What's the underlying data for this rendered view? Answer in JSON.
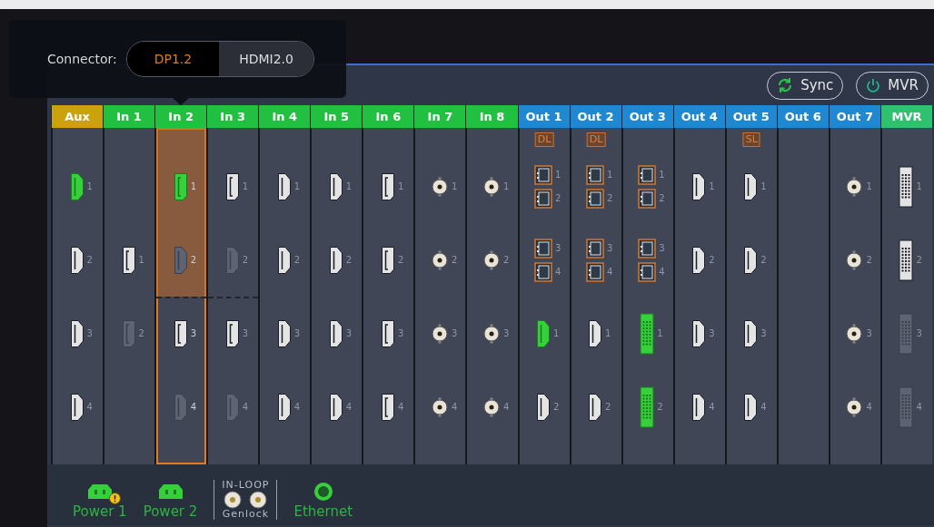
{
  "connector_popover": {
    "label": "Connector:",
    "options": [
      {
        "label": "DP1.2",
        "selected": true
      },
      {
        "label": "HDMI2.0",
        "selected": false
      }
    ]
  },
  "toolbar": {
    "buttons": [
      {
        "label": "Sync",
        "kind": "sync"
      },
      {
        "label": "MVR",
        "kind": "power"
      }
    ]
  },
  "columns": [
    {
      "label": "Aux",
      "kind": "aux",
      "selected": false,
      "slots": [
        [
          {
            "kind": "hdmi",
            "connected": true,
            "disabled": false,
            "label": "1"
          }
        ],
        [
          {
            "kind": "hdmi",
            "connected": false,
            "disabled": false,
            "label": "2"
          }
        ],
        [
          {
            "kind": "hdmi",
            "connected": false,
            "disabled": false,
            "label": "3"
          }
        ],
        [
          {
            "kind": "hdmi",
            "connected": false,
            "disabled": false,
            "label": "4"
          }
        ]
      ]
    },
    {
      "label": "In 1",
      "kind": "input",
      "selected": false,
      "slots": [
        [
          {
            "kind": "dp",
            "connected": false,
            "disabled": false,
            "label": "1"
          }
        ],
        [
          {
            "kind": "dp",
            "connected": false,
            "disabled": true,
            "label": "2"
          }
        ]
      ]
    },
    {
      "label": "In 2",
      "kind": "input",
      "selected": true,
      "slots": [
        [
          {
            "kind": "dp",
            "connected": true,
            "disabled": false,
            "label": "1"
          }
        ],
        [
          {
            "kind": "hdmi",
            "connected": false,
            "disabled": true,
            "label": "2"
          }
        ],
        [
          {
            "kind": "dp",
            "connected": false,
            "disabled": false,
            "label": "3"
          }
        ],
        [
          {
            "kind": "hdmi",
            "connected": false,
            "disabled": true,
            "label": "4"
          }
        ]
      ]
    },
    {
      "label": "In 3",
      "kind": "input",
      "selected": false,
      "slots": [
        [
          {
            "kind": "dp",
            "connected": false,
            "disabled": false,
            "label": "1"
          }
        ],
        [
          {
            "kind": "hdmi",
            "connected": false,
            "disabled": true,
            "label": "2"
          }
        ],
        [
          {
            "kind": "dp",
            "connected": false,
            "disabled": false,
            "label": "3"
          }
        ],
        [
          {
            "kind": "hdmi",
            "connected": false,
            "disabled": true,
            "label": "4"
          }
        ]
      ]
    },
    {
      "label": "In 4",
      "kind": "input",
      "selected": false,
      "slots": [
        [
          {
            "kind": "hdmi",
            "connected": false,
            "disabled": false,
            "label": "1"
          }
        ],
        [
          {
            "kind": "hdmi",
            "connected": false,
            "disabled": false,
            "label": "2"
          }
        ],
        [
          {
            "kind": "hdmi",
            "connected": false,
            "disabled": false,
            "label": "3"
          }
        ],
        [
          {
            "kind": "hdmi",
            "connected": false,
            "disabled": false,
            "label": "4"
          }
        ]
      ]
    },
    {
      "label": "In 5",
      "kind": "input",
      "selected": false,
      "slots": [
        [
          {
            "kind": "hdmi",
            "connected": false,
            "disabled": false,
            "label": "1"
          }
        ],
        [
          {
            "kind": "hdmi",
            "connected": false,
            "disabled": false,
            "label": "2"
          }
        ],
        [
          {
            "kind": "hdmi",
            "connected": false,
            "disabled": false,
            "label": "3"
          }
        ],
        [
          {
            "kind": "hdmi",
            "connected": false,
            "disabled": false,
            "label": "4"
          }
        ]
      ]
    },
    {
      "label": "In 6",
      "kind": "input",
      "selected": false,
      "slots": [
        [
          {
            "kind": "dp",
            "connected": false,
            "disabled": false,
            "label": "1"
          }
        ],
        [
          {
            "kind": "dp",
            "connected": false,
            "disabled": false,
            "label": "2"
          }
        ],
        [
          {
            "kind": "dp",
            "connected": false,
            "disabled": false,
            "label": "3"
          }
        ],
        [
          {
            "kind": "dp",
            "connected": false,
            "disabled": false,
            "label": "4"
          }
        ]
      ]
    },
    {
      "label": "In 7",
      "kind": "input",
      "selected": false,
      "slots": [
        [
          {
            "kind": "bnc",
            "connected": false,
            "disabled": false,
            "label": "1"
          }
        ],
        [
          {
            "kind": "bnc",
            "connected": false,
            "disabled": false,
            "label": "2"
          }
        ],
        [
          {
            "kind": "bnc",
            "connected": false,
            "disabled": false,
            "label": "3"
          }
        ],
        [
          {
            "kind": "bnc",
            "connected": false,
            "disabled": false,
            "label": "4"
          }
        ]
      ]
    },
    {
      "label": "In 8",
      "kind": "input",
      "selected": false,
      "slots": [
        [
          {
            "kind": "bnc",
            "connected": false,
            "disabled": false,
            "label": "1"
          }
        ],
        [
          {
            "kind": "bnc",
            "connected": false,
            "disabled": false,
            "label": "2"
          }
        ],
        [
          {
            "kind": "bnc",
            "connected": false,
            "disabled": false,
            "label": "3"
          }
        ],
        [
          {
            "kind": "bnc",
            "connected": false,
            "disabled": false,
            "label": "4"
          }
        ]
      ]
    },
    {
      "label": "Out 1",
      "kind": "output",
      "selected": false,
      "badge": "DL",
      "slots": [
        [
          {
            "kind": "sfp",
            "connected": false,
            "disabled": false,
            "label": "1"
          },
          {
            "kind": "sfp",
            "connected": false,
            "disabled": false,
            "label": "2"
          }
        ],
        [
          {
            "kind": "sfp",
            "connected": false,
            "disabled": false,
            "label": "3"
          },
          {
            "kind": "sfp",
            "connected": false,
            "disabled": false,
            "label": "4"
          }
        ],
        [
          {
            "kind": "hdmi",
            "connected": true,
            "disabled": false,
            "label": "1"
          }
        ],
        [
          {
            "kind": "hdmi",
            "connected": false,
            "disabled": false,
            "label": "2"
          }
        ]
      ]
    },
    {
      "label": "Out 2",
      "kind": "output",
      "selected": false,
      "badge": "DL",
      "slots": [
        [
          {
            "kind": "sfp",
            "connected": false,
            "disabled": false,
            "label": "1"
          },
          {
            "kind": "sfp",
            "connected": false,
            "disabled": false,
            "label": "2"
          }
        ],
        [
          {
            "kind": "sfp",
            "connected": false,
            "disabled": false,
            "label": "3"
          },
          {
            "kind": "sfp",
            "connected": false,
            "disabled": false,
            "label": "4"
          }
        ],
        [
          {
            "kind": "hdmi",
            "connected": false,
            "disabled": false,
            "label": "1"
          }
        ],
        [
          {
            "kind": "hdmi",
            "connected": false,
            "disabled": false,
            "label": "2"
          }
        ]
      ]
    },
    {
      "label": "Out 3",
      "kind": "output",
      "selected": false,
      "slots": [
        [
          {
            "kind": "sfp",
            "connected": false,
            "disabled": false,
            "label": "1"
          },
          {
            "kind": "sfp",
            "connected": false,
            "disabled": false,
            "label": "2"
          }
        ],
        [
          {
            "kind": "sfp",
            "connected": false,
            "disabled": false,
            "label": "3"
          },
          {
            "kind": "sfp",
            "connected": false,
            "disabled": false,
            "label": "4"
          }
        ],
        [
          {
            "kind": "dvi",
            "connected": true,
            "disabled": false,
            "label": "1"
          }
        ],
        [
          {
            "kind": "dvi",
            "connected": true,
            "disabled": false,
            "label": "2"
          }
        ]
      ]
    },
    {
      "label": "Out 4",
      "kind": "output",
      "selected": false,
      "slots": [
        [
          {
            "kind": "hdmi",
            "connected": false,
            "disabled": false,
            "label": "1"
          }
        ],
        [
          {
            "kind": "hdmi",
            "connected": false,
            "disabled": false,
            "label": "2"
          }
        ],
        [
          {
            "kind": "hdmi",
            "connected": false,
            "disabled": false,
            "label": "3"
          }
        ],
        [
          {
            "kind": "hdmi",
            "connected": false,
            "disabled": false,
            "label": "4"
          }
        ]
      ]
    },
    {
      "label": "Out 5",
      "kind": "output",
      "selected": false,
      "badge": "SL",
      "slots": [
        [
          {
            "kind": "hdmi",
            "connected": false,
            "disabled": false,
            "label": "1"
          }
        ],
        [
          {
            "kind": "hdmi",
            "connected": false,
            "disabled": false,
            "label": "2"
          }
        ],
        [
          {
            "kind": "hdmi",
            "connected": false,
            "disabled": false,
            "label": "3"
          }
        ],
        [
          {
            "kind": "hdmi",
            "connected": false,
            "disabled": false,
            "label": "4"
          }
        ]
      ]
    },
    {
      "label": "Out 6",
      "kind": "output",
      "selected": false
    },
    {
      "label": "Out 7",
      "kind": "output",
      "selected": false,
      "slots": [
        [
          {
            "kind": "bnc",
            "connected": false,
            "disabled": false,
            "label": "1"
          }
        ],
        [
          {
            "kind": "bnc",
            "connected": false,
            "disabled": false,
            "label": "2"
          }
        ],
        [
          {
            "kind": "bnc",
            "connected": false,
            "disabled": false,
            "label": "3"
          }
        ],
        [
          {
            "kind": "bnc",
            "connected": false,
            "disabled": false,
            "label": "4"
          }
        ]
      ]
    },
    {
      "label": "MVR",
      "kind": "mvr",
      "selected": false,
      "slots": [
        [
          {
            "kind": "dvi",
            "connected": false,
            "disabled": false,
            "label": "1"
          }
        ],
        [
          {
            "kind": "dvi",
            "connected": false,
            "disabled": false,
            "label": "2"
          }
        ],
        [
          {
            "kind": "dvi",
            "connected": false,
            "disabled": true,
            "label": "3"
          }
        ],
        [
          {
            "kind": "dvi",
            "connected": false,
            "disabled": true,
            "label": "4"
          }
        ]
      ]
    }
  ],
  "rear_panel": [
    {
      "kind": "power",
      "label": "Power 1",
      "warning": true
    },
    {
      "kind": "power",
      "label": "Power 2",
      "warning": false
    },
    {
      "kind": "genlock",
      "top_label": "IN-LOOP",
      "label": "Genlock"
    },
    {
      "kind": "ethernet",
      "label": "Ethernet"
    }
  ]
}
